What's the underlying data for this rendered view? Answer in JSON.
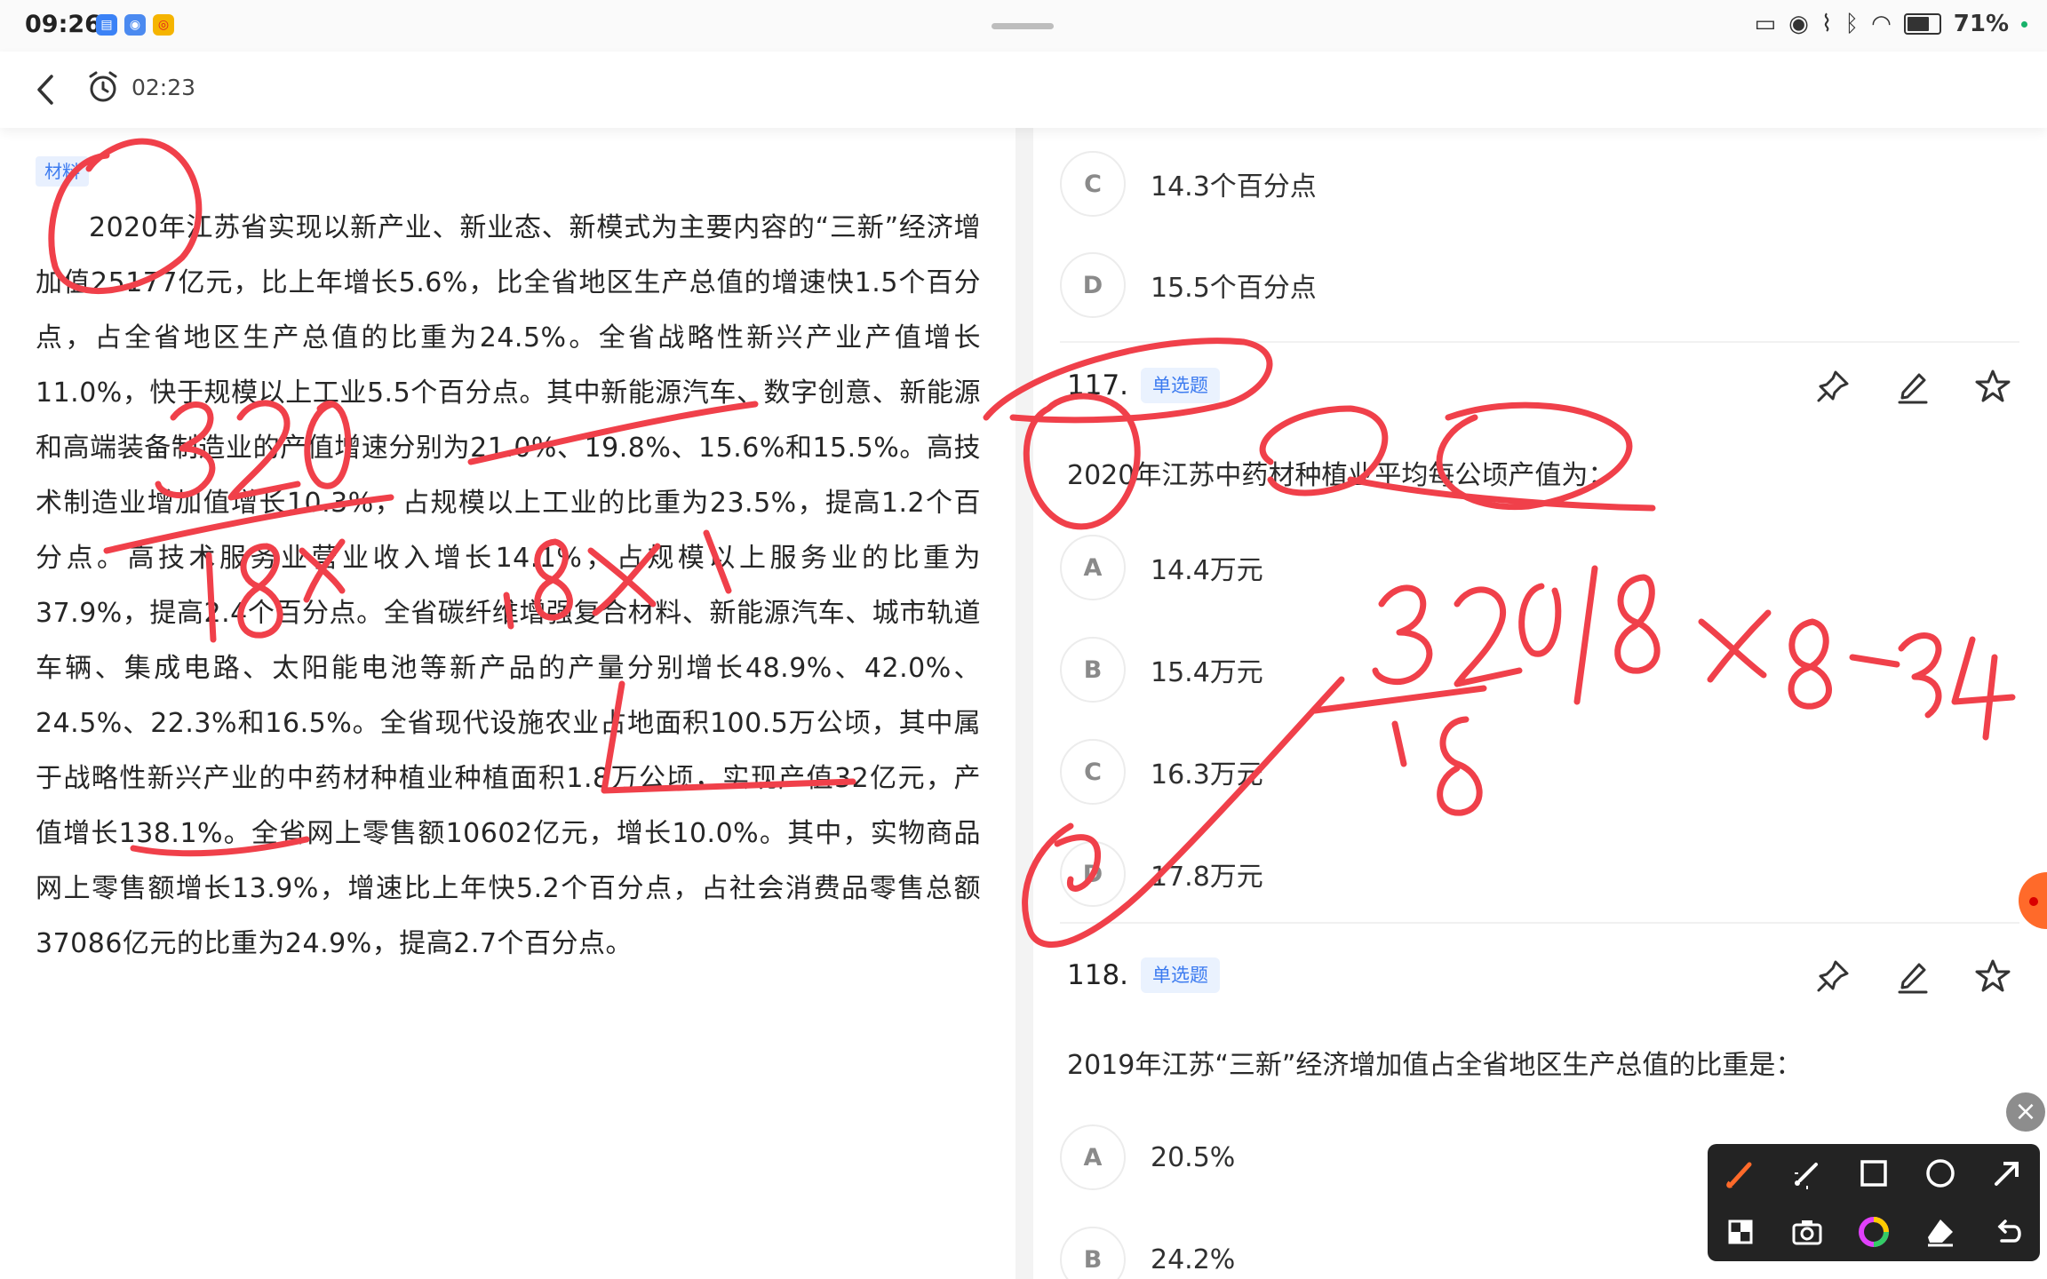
{
  "status_bar": {
    "time": "09:26",
    "battery_percent": "71%",
    "battery_level": 0.71
  },
  "header": {
    "timer": "02:23"
  },
  "material": {
    "tag": "材料",
    "text": "2020年江苏省实现以新产业、新业态、新模式为主要内容的“三新”经济增加值25177亿元，比上年增长5.6%，比全省地区生产总值的增速快1.5个百分点，占全省地区生产总值的比重为24.5%。全省战略性新兴产业产值增长11.0%，快于规模以上工业5.5个百分点。其中新能源汽车、数字创意、新能源和高端装备制造业的产值增速分别为21.0%、19.8%、15.6%和15.5%。高技术制造业增加值增长10.3%，占规模以上工业的比重为23.5%，提高1.2个百分点。高技术服务业营业收入增长14.1%，占规模以上服务业的比重为37.9%，提高2.4个百分点。全省碳纤维增强复合材料、新能源汽车、城市轨道车辆、集成电路、太阳能电池等新产品的产量分别增长48.9%、42.0%、24.5%、22.3%和16.5%。全省现代设施农业占地面积100.5万公顷，其中属于战略性新兴产业的中药材种植业种植面积1.8万公顷，实现产值32亿元，产值增长138.1%。全省网上零售额10602亿元，增长10.0%。其中，实物商品网上零售额增长13.9%，增速比上年快5.2个百分点，占社会消费品零售总额37086亿元的比重为24.9%，提高2.7个百分点。"
  },
  "prev_question": {
    "options": [
      {
        "letter": "C",
        "text": "14.3个百分点"
      },
      {
        "letter": "D",
        "text": "15.5个百分点"
      }
    ]
  },
  "question_117": {
    "number": "117.",
    "type": "单选题",
    "stem": "2020年江苏中药材种植业平均每公顷产值为：",
    "options": [
      {
        "letter": "A",
        "text": "14.4万元"
      },
      {
        "letter": "B",
        "text": "15.4万元"
      },
      {
        "letter": "C",
        "text": "16.3万元"
      },
      {
        "letter": "D",
        "text": "17.8万元"
      }
    ]
  },
  "question_118": {
    "number": "118.",
    "type": "单选题",
    "stem": "2019年江苏“三新”经济增加值占全省地区生产总值的比重是：",
    "options": [
      {
        "letter": "A",
        "text": "20.5%"
      },
      {
        "letter": "B",
        "text": "24.2%"
      }
    ]
  },
  "colors": {
    "accent_blue": "#3c7bf0",
    "ink_red": "#f0404a",
    "float_orange": "#ff6a2a"
  },
  "icons": {
    "header": [
      "back-arrow-icon",
      "alarm-clock-icon"
    ],
    "question_tools": [
      "pin-icon",
      "edit-pen-icon",
      "star-icon"
    ],
    "annotation_toolbar": [
      "brush-icon",
      "laser-pen-icon",
      "rectangle-icon",
      "circle-icon",
      "arrow-icon",
      "crop-icon",
      "camera-icon",
      "color-wheel-icon",
      "eraser-icon",
      "undo-icon"
    ]
  }
}
